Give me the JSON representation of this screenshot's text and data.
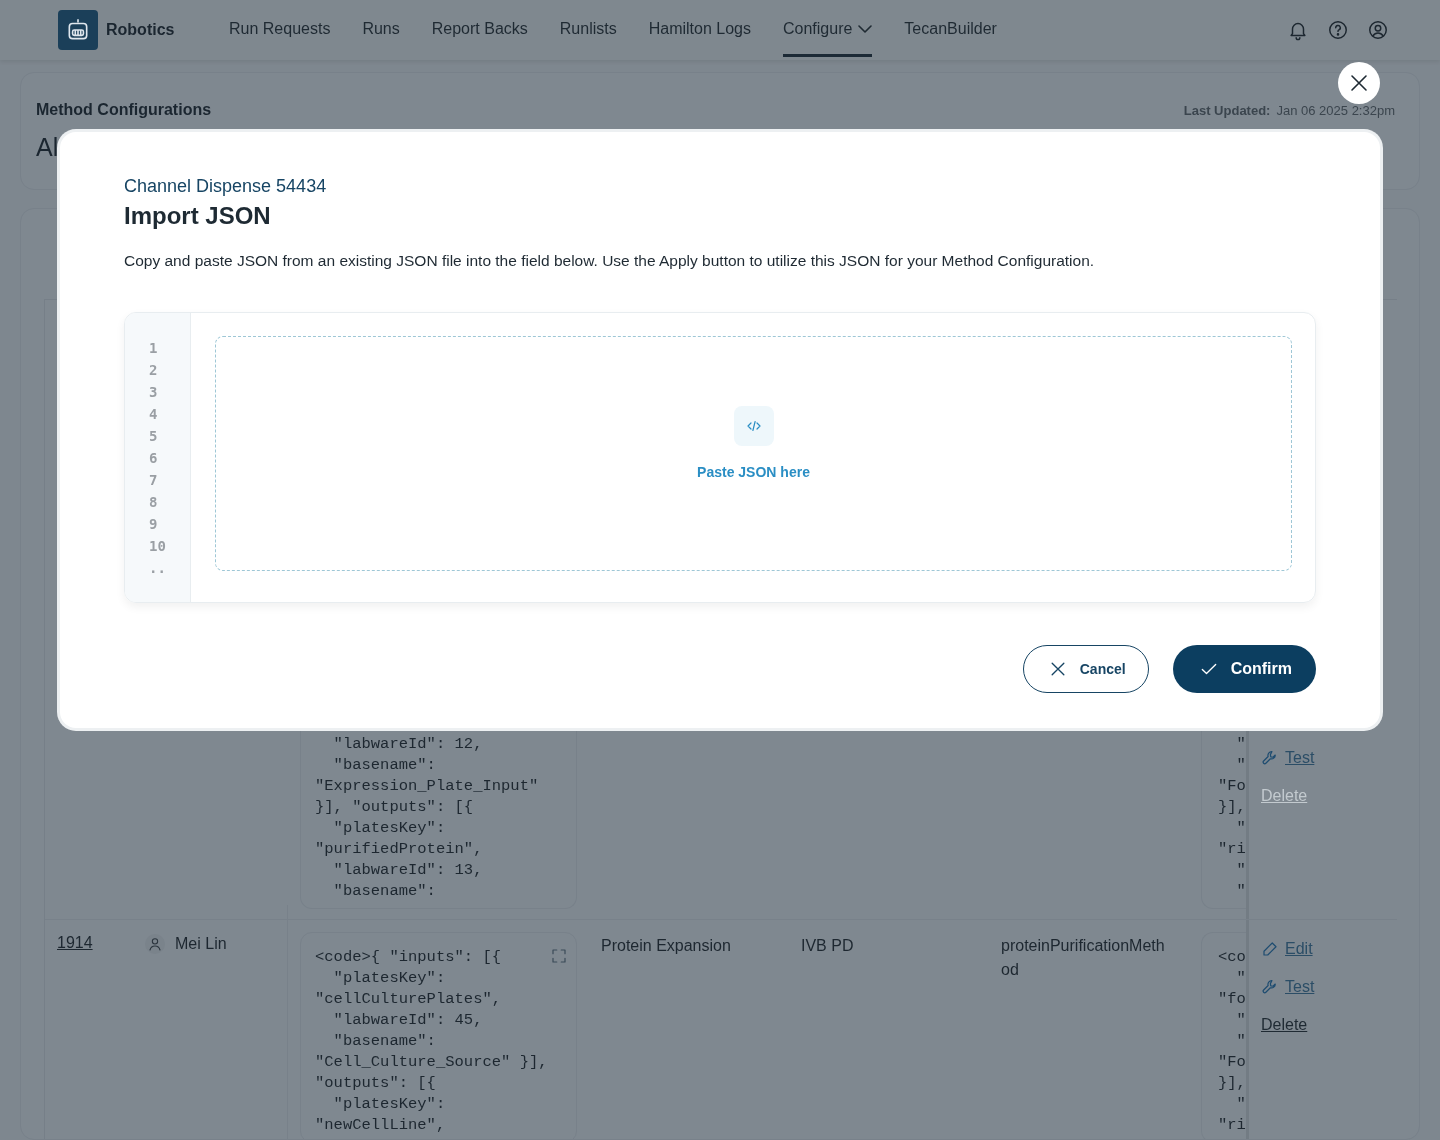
{
  "nav": {
    "brand": "Robotics",
    "items": [
      {
        "label": "Run Requests",
        "selected": false,
        "dropdown": false
      },
      {
        "label": "Runs",
        "selected": false,
        "dropdown": false
      },
      {
        "label": "Report Backs",
        "selected": false,
        "dropdown": false
      },
      {
        "label": "Runlists",
        "selected": false,
        "dropdown": false
      },
      {
        "label": "Hamilton Logs",
        "selected": false,
        "dropdown": false
      },
      {
        "label": "Configure",
        "selected": true,
        "dropdown": true
      },
      {
        "label": "TecanBuilder",
        "selected": false,
        "dropdown": false
      }
    ]
  },
  "header_card": {
    "title": "Method Configurations",
    "last_updated_label": "Last Updated:",
    "last_updated": "Jan 06 2025 2:32pm",
    "heading": "Al"
  },
  "table": {
    "rows": [
      {
        "code_lines": [
          "  \"labwareId\": 12,",
          "  \"basename\":",
          "\"Expression_Plate_Input\"",
          "}], \"outputs\": [{",
          "  \"platesKey\":",
          "\"purifiedProtein\",",
          "  \"labwareId\": 13,",
          "  \"basename\":"
        ],
        "code_2_lines": [
          "  \"",
          "  \"",
          "\"Fo",
          "}],",
          "  \"",
          "\"ri",
          "  \"",
          "  \""
        ],
        "actions": [
          {
            "kind": "test",
            "label": "Test",
            "disabled": false
          },
          {
            "kind": "delete",
            "label": "Delete",
            "disabled": true
          }
        ]
      },
      {
        "id": "1914",
        "user": "Mei Lin",
        "code_lines": [
          "<code>{ \"inputs\": [{",
          "  \"platesKey\":",
          "\"cellCulturePlates\",",
          "  \"labwareId\": 45,",
          "  \"basename\":",
          "\"Cell_Culture_Source\" }],",
          "\"outputs\": [{",
          "  \"platesKey\":",
          "\"newCellLine\","
        ],
        "category": "Protein Expansion",
        "group": "IVB PD",
        "method": "proteinPurificationMethod",
        "code_2_lines": [
          "<co",
          "  \"",
          "\"fo",
          "  \"",
          "  \"",
          "\"Fo",
          "}],",
          "  \"",
          "\"ri"
        ],
        "actions": [
          {
            "kind": "edit",
            "label": "Edit",
            "disabled": false
          },
          {
            "kind": "test",
            "label": "Test",
            "disabled": false
          },
          {
            "kind": "delete",
            "label": "Delete",
            "disabled": false
          }
        ]
      }
    ]
  },
  "modal": {
    "subtitle": "Channel Dispense 54434",
    "title": "Import JSON",
    "description": "Copy and paste JSON from an existing JSON file into the field below.  Use the Apply button to utilize this JSON for your Method Configuration.",
    "line_numbers": [
      "1",
      "2",
      "3",
      "4",
      "5",
      "6",
      "7",
      "8",
      "9",
      "10",
      ".."
    ],
    "placeholder": "Paste JSON here",
    "buttons": [
      {
        "kind": "cancel",
        "label": "Cancel"
      },
      {
        "kind": "confirm",
        "label": "Confirm"
      }
    ]
  }
}
